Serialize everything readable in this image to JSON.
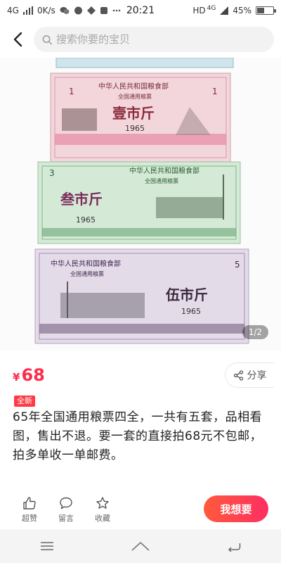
{
  "status_bar": {
    "network": "4G",
    "speed": "0K/s",
    "time": "20:21",
    "hd_label": "HD",
    "network_right": "4G",
    "battery": "45%"
  },
  "search": {
    "placeholder": "搜索你要的宝贝"
  },
  "gallery": {
    "page_indicator": "1/2"
  },
  "product": {
    "currency": "¥",
    "price": "68",
    "share_label": "分享",
    "badge": "全新",
    "description": "65年全国通用粮票四全，一共有五套，品相看图，售出不退。要一套的直接拍68元不包邮，拍多单收一单邮费。"
  },
  "actions": {
    "like_label": "超赞",
    "comment_label": "留言",
    "favorite_label": "收藏",
    "want_label": "我想要"
  },
  "colors": {
    "accent": "#ff2d4b",
    "badge": "#ff3a44"
  }
}
